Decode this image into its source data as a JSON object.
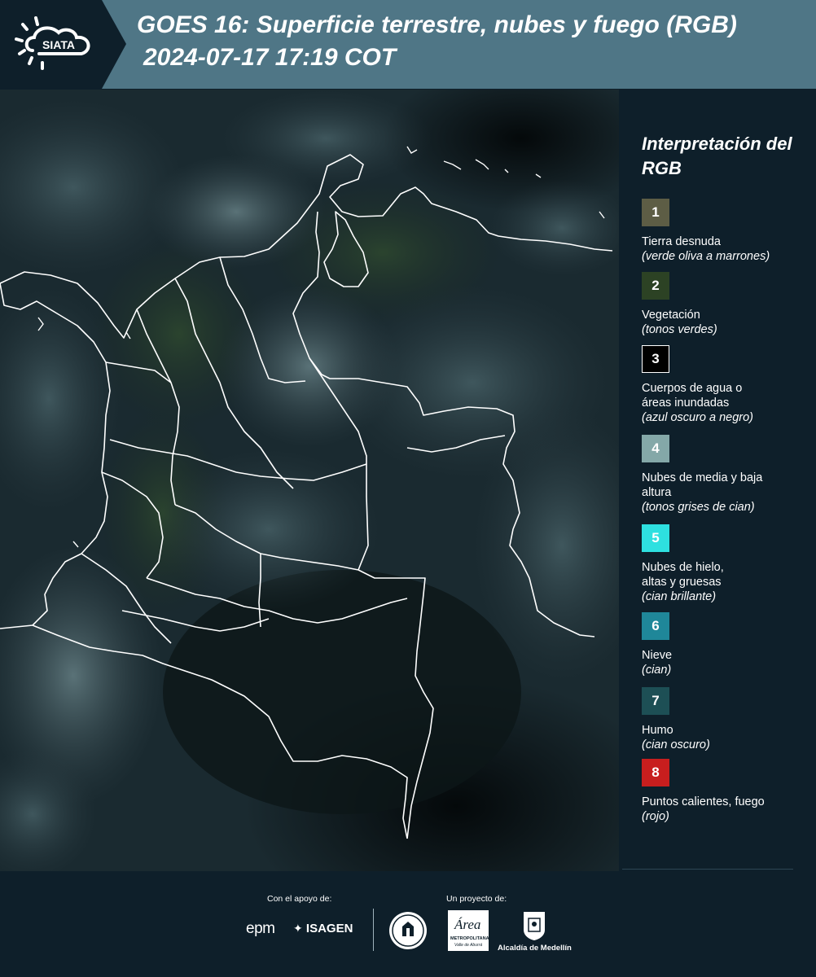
{
  "header": {
    "logo_text": "SIATA",
    "title": "GOES 16: Superficie terrestre, nubes y fuego (RGB)",
    "subtitle": "2024-07-17 17:19 COT",
    "background_color": "#4f7686",
    "logo_background_color": "#0e1f2a"
  },
  "legend": {
    "title": "Interpretación del RGB",
    "items": [
      {
        "number": "1",
        "label": "Tierra desnuda",
        "desc": "(verde oliva a marrones)",
        "color": "#5d5d45"
      },
      {
        "number": "2",
        "label": "Vegetación",
        "desc": "(tonos verdes)",
        "color": "#2c4224"
      },
      {
        "number": "3",
        "label": "Cuerpos de agua o áreas inundadas",
        "desc": "(azul oscuro a negro)",
        "color": "#000000"
      },
      {
        "number": "4",
        "label": "Nubes de media y baja altura",
        "desc": "(tonos grises de cian)",
        "color": "#84a8a8"
      },
      {
        "number": "5",
        "label": "Nubes de hielo, altas y gruesas",
        "desc": "(cian brillante)",
        "color": "#2ee0e0"
      },
      {
        "number": "6",
        "label": "Nieve",
        "desc": "(cian)",
        "color": "#1f8799"
      },
      {
        "number": "7",
        "label": "Humo",
        "desc": "(cian oscuro)",
        "color": "#1d4f55"
      },
      {
        "number": "8",
        "label": "Puntos calientes, fuego",
        "desc": "(rojo)",
        "color": "#c81e1e"
      }
    ]
  },
  "footer": {
    "support_label": "Con el apoyo de:",
    "project_label": "Un proyecto de:",
    "sponsors": [
      "epm",
      "ISAGEN"
    ],
    "partners": [
      "Área Metropolitana",
      "Alcaldía de Medellín"
    ],
    "area_logo_text": "Área",
    "area_logo_subtext": "METROPOLITANA",
    "area_logo_tagline": "Valle de Aburrá",
    "alcaldia_text": "Alcaldía de Medellín"
  },
  "map": {
    "background_color": "#0a1418",
    "boundary_color": "#ffffff"
  }
}
